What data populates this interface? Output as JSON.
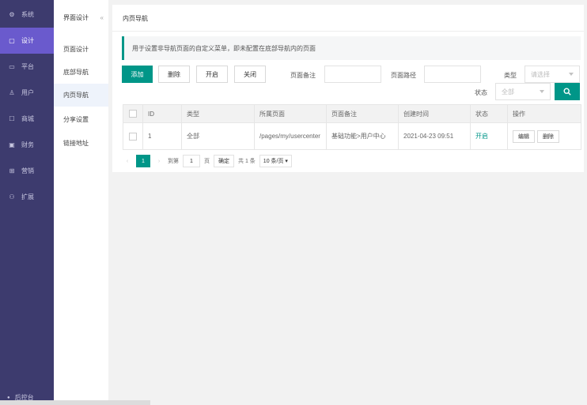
{
  "sidebar": {
    "items": [
      {
        "icon": "gear-icon",
        "glyph": "⚙",
        "label": "系统"
      },
      {
        "icon": "design-icon",
        "glyph": "▢",
        "label": "设计"
      },
      {
        "icon": "platform-icon",
        "glyph": "▭",
        "label": "平台"
      },
      {
        "icon": "user-icon",
        "glyph": "♙",
        "label": "用户"
      },
      {
        "icon": "mall-icon",
        "glyph": "☐",
        "label": "商城"
      },
      {
        "icon": "finance-icon",
        "glyph": "▣",
        "label": "财务"
      },
      {
        "icon": "marketing-icon",
        "glyph": "⊞",
        "label": "营销"
      },
      {
        "icon": "extend-icon",
        "glyph": "⚇",
        "label": "扩展"
      }
    ],
    "bottom": {
      "glyph": "●",
      "label": "后控台"
    }
  },
  "subnav": {
    "title": "界面设计",
    "collapse_glyph": "«",
    "items": [
      {
        "label": "页面设计"
      },
      {
        "label": "底部导航"
      },
      {
        "label": "内页导航"
      },
      {
        "label": "分享设置"
      },
      {
        "label": "链接地址"
      }
    ]
  },
  "main": {
    "title": "内页导航",
    "tip": "用于设置非导航页面的自定义菜单，即未配置在底部导航内的页面"
  },
  "toolbar": {
    "add": "添加",
    "delete": "删除",
    "enable": "开启",
    "disable": "关闭"
  },
  "filters": {
    "remark_label": "页面备注",
    "path_label": "页面路径",
    "type_label": "类型",
    "type_placeholder": "请选择",
    "status_label": "状态",
    "status_value": "全部"
  },
  "table": {
    "headers": [
      "ID",
      "类型",
      "所属页面",
      "页面备注",
      "创建时间",
      "状态",
      "操作"
    ],
    "rows": [
      {
        "id": "1",
        "type": "全部",
        "page": "/pages/my/usercenter",
        "remark": "基础功能>用户中心",
        "created": "2021-04-23 09:51",
        "status": "开启",
        "edit": "编辑",
        "delete": "删除"
      }
    ]
  },
  "pager": {
    "current": "1",
    "goto_label": "到第",
    "goto_value": "1",
    "page_label": "页",
    "confirm": "确定",
    "total": "共 1 条",
    "page_size": "10 条/页"
  },
  "colors": {
    "accent": "#009688",
    "sidebar": "#3d3b6e",
    "sidebar_active": "#6a5acd"
  }
}
